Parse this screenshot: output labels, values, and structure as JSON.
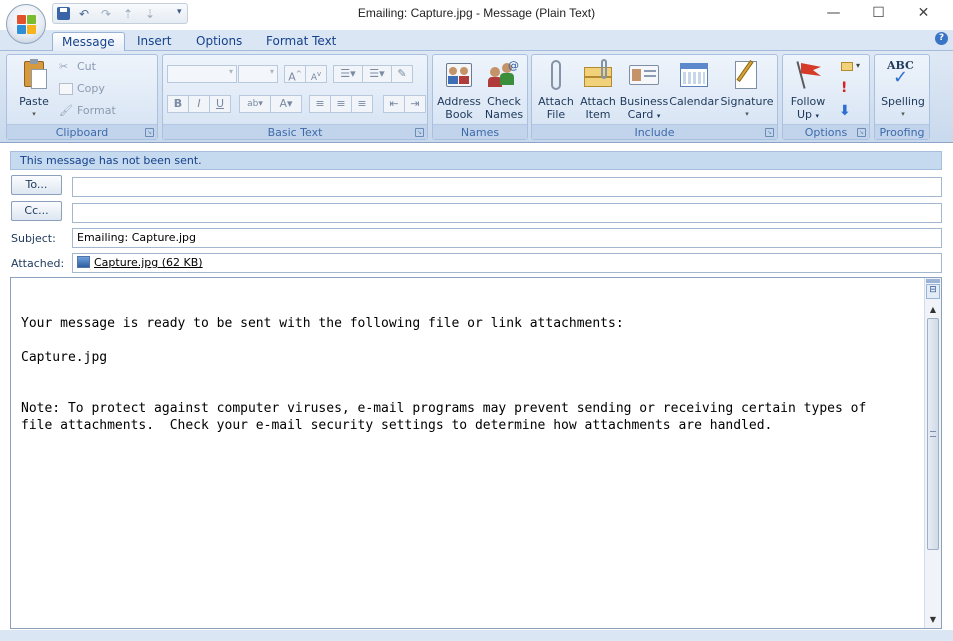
{
  "window": {
    "title": "Emailing: Capture.jpg - Message (Plain Text)",
    "minimize_icon": "minimize-icon",
    "maximize_icon": "maximize-icon",
    "close_icon": "close-icon"
  },
  "quick_access": {
    "icons": [
      "save-icon",
      "undo-icon",
      "redo-icon",
      "previous-item-icon",
      "next-item-icon",
      "customize-icon"
    ]
  },
  "tabs": [
    {
      "label": "Message",
      "active": true
    },
    {
      "label": "Insert",
      "active": false
    },
    {
      "label": "Options",
      "active": false
    },
    {
      "label": "Format Text",
      "active": false
    }
  ],
  "ribbon": {
    "clipboard": {
      "title": "Clipboard",
      "paste": "Paste",
      "cut": "Cut",
      "copy": "Copy",
      "format_painter": "Format Painter"
    },
    "basic_text": {
      "title": "Basic Text",
      "buttons": [
        "B",
        "I",
        "U"
      ]
    },
    "names": {
      "title": "Names",
      "address_book_1": "Address",
      "address_book_2": "Book",
      "check_names_1": "Check",
      "check_names_2": "Names"
    },
    "include": {
      "title": "Include",
      "attach_file_1": "Attach",
      "attach_file_2": "File",
      "attach_item_1": "Attach",
      "attach_item_2": "Item",
      "business_card_1": "Business",
      "business_card_2": "Card",
      "calendar": "Calendar",
      "signature": "Signature"
    },
    "options": {
      "title": "Options",
      "follow_up_1": "Follow",
      "follow_up_2": "Up"
    },
    "proofing": {
      "title": "Proofing",
      "spelling": "Spelling",
      "abc": "ABC"
    }
  },
  "infobar": "This message has not been sent.",
  "header": {
    "to_button": "To...",
    "cc_button": "Cc...",
    "to_value": "",
    "cc_value": "",
    "subject_label": "Subject:",
    "subject_value": "Emailing: Capture.jpg",
    "attached_label": "Attached:",
    "attachment": "Capture.jpg (62 KB)"
  },
  "body": {
    "text": "Your message is ready to be sent with the following file or link attachments:\n\nCapture.jpg\n\n\nNote: To protect against computer viruses, e-mail programs may prevent sending or receiving certain types of\nfile attachments.  Check your e-mail security settings to determine how attachments are handled."
  },
  "colors": {
    "ribbon": "#dfe9f5",
    "accent": "#15428b",
    "infobar": "#c5d9ef"
  }
}
